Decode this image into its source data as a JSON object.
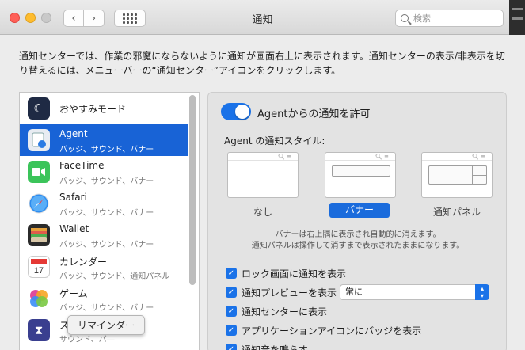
{
  "window": {
    "title": "通知"
  },
  "search": {
    "placeholder": "検索"
  },
  "description": "通知センターでは、作業の邪魔にならないように通知が画面右上に表示されます。通知センターの表示/非表示を切り替えるには、メニューバーの“通知センター”アイコンをクリックします。",
  "apps": [
    {
      "name": "おやすみモード",
      "sub": "",
      "icon": "moon-icon",
      "color": "#1f2a44"
    },
    {
      "name": "Agent",
      "sub": "バッジ、サウンド、バナー",
      "icon": "agent-icon",
      "color": "#e8ecf2",
      "selected": true
    },
    {
      "name": "FaceTime",
      "sub": "バッジ、サウンド、バナー",
      "icon": "facetime-icon",
      "color": "#3bc45a"
    },
    {
      "name": "Safari",
      "sub": "バッジ、サウンド、バナー",
      "icon": "safari-icon",
      "color": "#2d8cf0"
    },
    {
      "name": "Wallet",
      "sub": "バッジ、サウンド、バナー",
      "icon": "wallet-icon",
      "color": "#2b2b2b"
    },
    {
      "name": "カレンダー",
      "sub": "バッジ、サウンド、通知パネル",
      "icon": "calendar-icon",
      "color": "#ffffff"
    },
    {
      "name": "ゲーム",
      "sub": "バッジ、サウンド、バナー",
      "icon": "game-center-icon",
      "color": "#f0f0f0"
    },
    {
      "name": "ス",
      "sub": "サウンド、バ―",
      "icon": "screen-time-icon",
      "color": "#3a3f8f"
    }
  ],
  "tooltip": "リマインダー",
  "panel": {
    "allow_label": "Agentからの通知を許可",
    "style_title": "Agent の通知スタイル:",
    "styles": [
      "なし",
      "バナー",
      "通知パネル"
    ],
    "selected_style": "バナー",
    "note_line1": "バナーは右上隅に表示され自動的に消えます。",
    "note_line2": "通知パネルは操作して消すまで表示されたままになります。",
    "options": [
      {
        "label": "ロック画面に通知を表示",
        "checked": true
      },
      {
        "label": "通知プレビューを表示",
        "checked": true
      },
      {
        "label": "通知センターに表示",
        "checked": true
      },
      {
        "label": "アプリケーションアイコンにバッジを表示",
        "checked": true
      },
      {
        "label": "通知音を鳴らす",
        "checked": true
      }
    ],
    "preview_select": "常に"
  },
  "colors": {
    "accent": "#1a72e8",
    "selection": "#1863d6"
  }
}
